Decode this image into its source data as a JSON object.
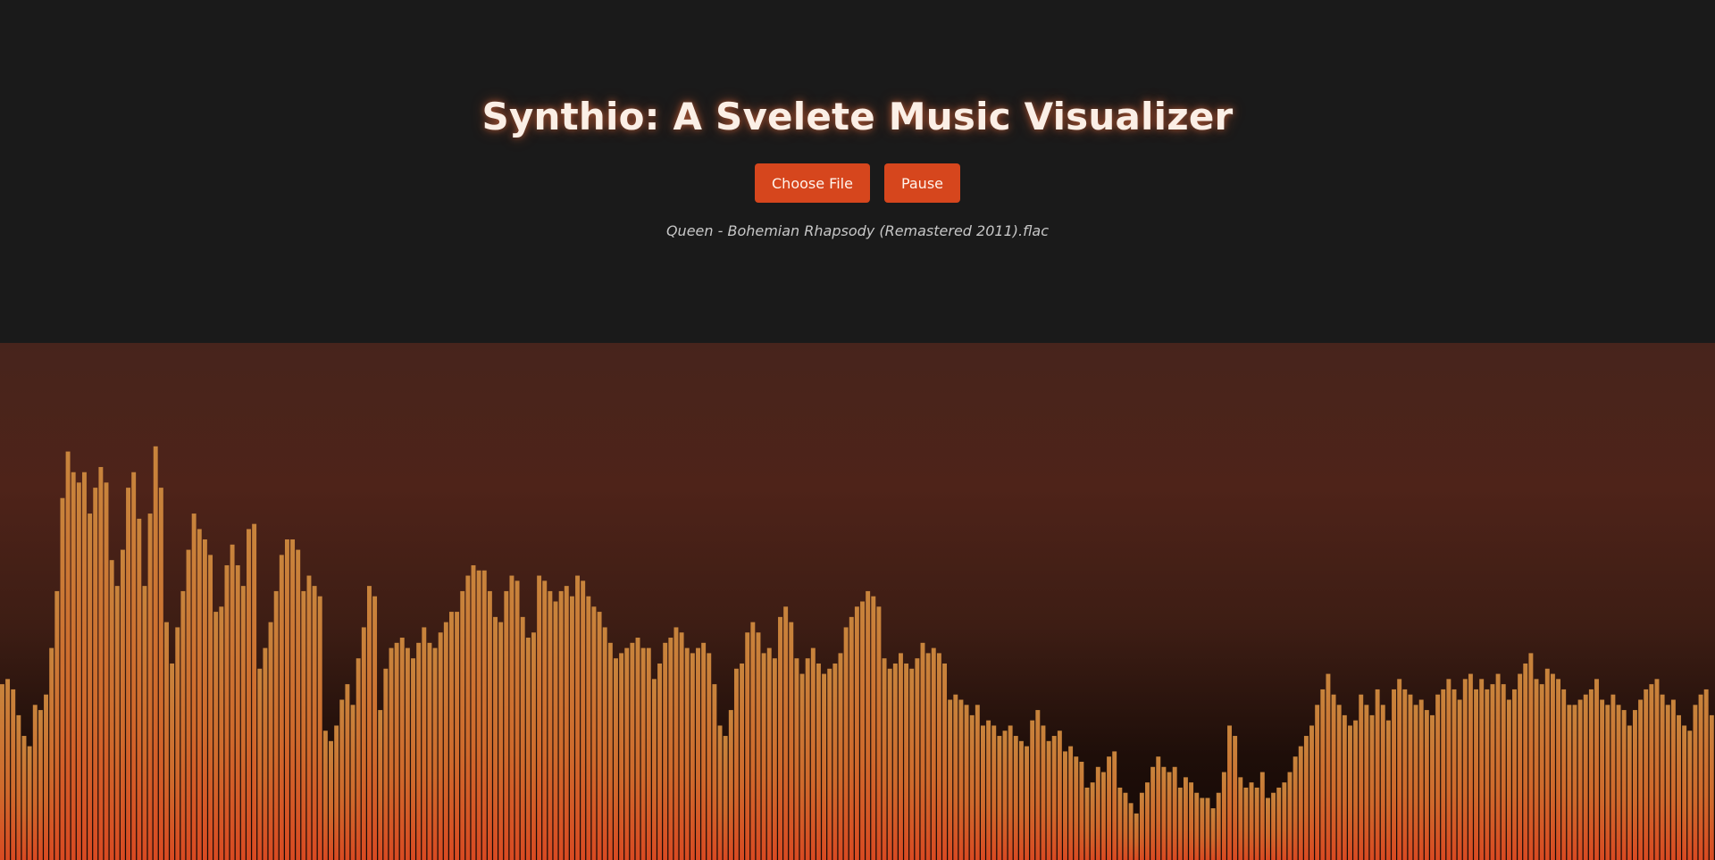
{
  "app": {
    "title": "Synthio: A Svelete Music Visualizer"
  },
  "controls": {
    "choose_file_label": "Choose File",
    "pause_label": "Pause"
  },
  "now_playing": {
    "filename": "Queen - Bohemian Rhapsody (Remastered 2011).flac"
  },
  "colors": {
    "accent": "#d6461d",
    "bar_top": "#c8843c",
    "bar_bottom": "#d84a22",
    "page_background": "#1a1a1a"
  },
  "spectrum": {
    "levels": [
      0.34,
      0.35,
      0.33,
      0.28,
      0.24,
      0.22,
      0.3,
      0.29,
      0.32,
      0.41,
      0.52,
      0.7,
      0.79,
      0.75,
      0.73,
      0.75,
      0.67,
      0.72,
      0.76,
      0.73,
      0.58,
      0.53,
      0.6,
      0.72,
      0.75,
      0.66,
      0.53,
      0.67,
      0.8,
      0.72,
      0.46,
      0.38,
      0.45,
      0.52,
      0.6,
      0.67,
      0.64,
      0.62,
      0.59,
      0.48,
      0.49,
      0.57,
      0.61,
      0.57,
      0.53,
      0.64,
      0.65,
      0.37,
      0.41,
      0.46,
      0.52,
      0.59,
      0.62,
      0.62,
      0.6,
      0.52,
      0.55,
      0.53,
      0.51,
      0.25,
      0.23,
      0.26,
      0.31,
      0.34,
      0.3,
      0.39,
      0.45,
      0.53,
      0.51,
      0.29,
      0.37,
      0.41,
      0.42,
      0.43,
      0.41,
      0.39,
      0.42,
      0.45,
      0.42,
      0.41,
      0.44,
      0.46,
      0.48,
      0.48,
      0.52,
      0.55,
      0.57,
      0.56,
      0.56,
      0.52,
      0.47,
      0.46,
      0.52,
      0.55,
      0.54,
      0.47,
      0.43,
      0.44,
      0.55,
      0.54,
      0.52,
      0.5,
      0.52,
      0.53,
      0.51,
      0.55,
      0.54,
      0.51,
      0.49,
      0.48,
      0.45,
      0.42,
      0.39,
      0.4,
      0.41,
      0.42,
      0.43,
      0.41,
      0.41,
      0.35,
      0.38,
      0.42,
      0.43,
      0.45,
      0.44,
      0.41,
      0.4,
      0.41,
      0.42,
      0.4,
      0.34,
      0.26,
      0.24,
      0.29,
      0.37,
      0.38,
      0.44,
      0.46,
      0.44,
      0.4,
      0.41,
      0.39,
      0.47,
      0.49,
      0.46,
      0.39,
      0.36,
      0.39,
      0.41,
      0.38,
      0.36,
      0.37,
      0.38,
      0.4,
      0.45,
      0.47,
      0.49,
      0.5,
      0.52,
      0.51,
      0.49,
      0.39,
      0.37,
      0.38,
      0.4,
      0.38,
      0.37,
      0.39,
      0.42,
      0.4,
      0.41,
      0.4,
      0.38,
      0.31,
      0.32,
      0.31,
      0.3,
      0.28,
      0.3,
      0.26,
      0.27,
      0.26,
      0.24,
      0.25,
      0.26,
      0.24,
      0.23,
      0.22,
      0.27,
      0.29,
      0.26,
      0.23,
      0.24,
      0.25,
      0.21,
      0.22,
      0.2,
      0.19,
      0.14,
      0.15,
      0.18,
      0.17,
      0.2,
      0.21,
      0.14,
      0.13,
      0.11,
      0.09,
      0.13,
      0.15,
      0.18,
      0.2,
      0.18,
      0.17,
      0.18,
      0.14,
      0.16,
      0.15,
      0.13,
      0.12,
      0.12,
      0.1,
      0.13,
      0.17,
      0.26,
      0.24,
      0.16,
      0.14,
      0.15,
      0.14,
      0.17,
      0.12,
      0.13,
      0.14,
      0.15,
      0.17,
      0.2,
      0.22,
      0.24,
      0.26,
      0.3,
      0.33,
      0.36,
      0.32,
      0.3,
      0.28,
      0.26,
      0.27,
      0.32,
      0.3,
      0.28,
      0.33,
      0.3,
      0.27,
      0.33,
      0.35,
      0.33,
      0.32,
      0.3,
      0.31,
      0.29,
      0.28,
      0.32,
      0.33,
      0.35,
      0.33,
      0.31,
      0.35,
      0.36,
      0.33,
      0.35,
      0.33,
      0.34,
      0.36,
      0.34,
      0.31,
      0.33,
      0.36,
      0.38,
      0.4,
      0.35,
      0.34,
      0.37,
      0.36,
      0.35,
      0.33,
      0.3,
      0.3,
      0.31,
      0.32,
      0.33,
      0.35,
      0.31,
      0.3,
      0.32,
      0.3,
      0.29,
      0.26,
      0.29,
      0.31,
      0.33,
      0.34,
      0.35,
      0.32,
      0.3,
      0.31,
      0.28,
      0.26,
      0.25,
      0.3,
      0.32,
      0.33,
      0.28
    ]
  }
}
